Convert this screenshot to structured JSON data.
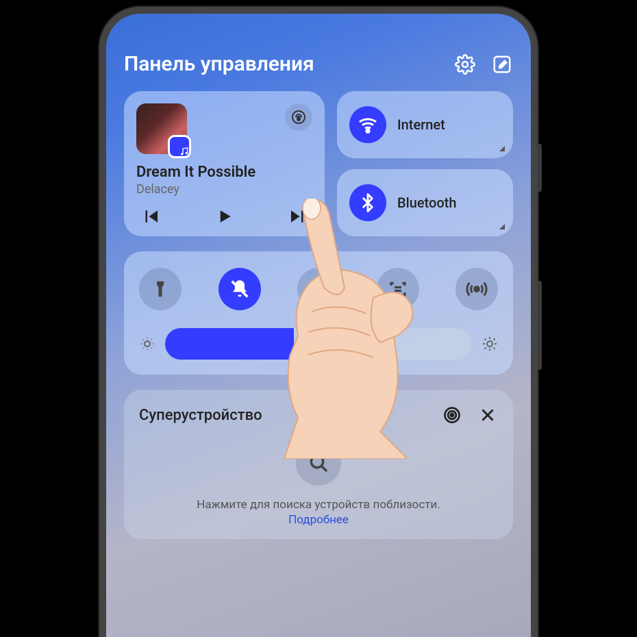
{
  "header": {
    "title": "Панель управления"
  },
  "music": {
    "title": "Dream It Possible",
    "artist": "Delacey"
  },
  "connectivity": {
    "internet_label": "Internet",
    "bluetooth_label": "Bluetooth"
  },
  "toggles": {
    "icons": [
      "flashlight",
      "mute",
      "scan",
      "screenshot",
      "hotspot"
    ],
    "active_index": 1,
    "brightness_percent": 42
  },
  "super_device": {
    "title": "Суперустройство",
    "hint": "Нажмите для поиска устройств поблизости.",
    "link": "Подробнее"
  },
  "colors": {
    "accent": "#333cff"
  }
}
